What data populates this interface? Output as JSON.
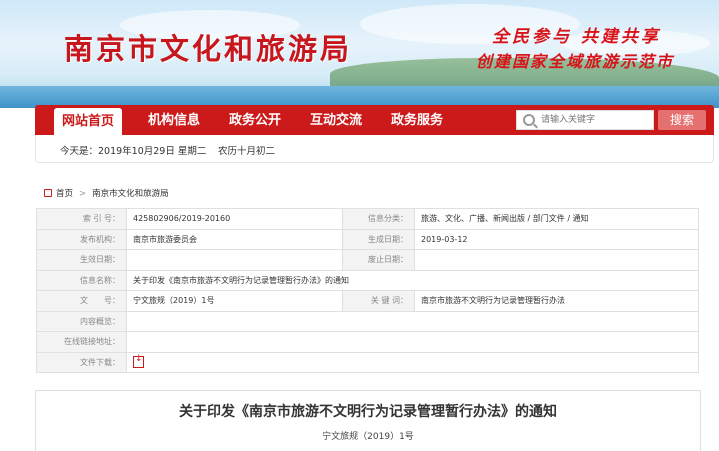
{
  "header": {
    "site_title": "南京市文化和旅游局",
    "slogan_line1": "全民参与 共建共享",
    "slogan_line2": "创建国家全域旅游示范市"
  },
  "nav": {
    "items": [
      {
        "label": "网站首页",
        "active": true
      },
      {
        "label": "机构信息"
      },
      {
        "label": "政务公开"
      },
      {
        "label": "互动交流"
      },
      {
        "label": "政务服务"
      }
    ],
    "search_placeholder": "请输入关键字",
    "search_button": "搜索"
  },
  "datebar": {
    "date": "今天是：2019年10月29日 星期二",
    "lunar": "农历十月初二"
  },
  "breadcrumb": {
    "home": "首页",
    "separator": ">",
    "current": "南京市文化和旅游局"
  },
  "info_table": {
    "index_label": "索 引 号：",
    "index_value": "425802906/2019-20160",
    "category_label": "信息分类：",
    "category_value": "旅游、文化、广播、新闻出版 / 部门文件 / 通知",
    "publisher_label": "发布机构：",
    "publisher_value": "南京市旅游委员会",
    "created_label": "生成日期：",
    "created_value": "2019-03-12",
    "effective_label": "生效日期：",
    "effective_value": "",
    "expire_label": "废止日期：",
    "expire_value": "",
    "name_label": "信息名称：",
    "name_value": "关于印发《南京市旅游不文明行为记录管理暂行办法》的通知",
    "docno_label": "文　　号：",
    "docno_value": "宁文旅规（2019）1号",
    "keywords_label": "关 键 词：",
    "keywords_value": "南京市旅游不文明行为记录管理暂行办法",
    "overview_label": "内容概览：",
    "overview_value": "",
    "link_label": "在线链接地址：",
    "link_value": "",
    "download_label": "文件下载：",
    "download_icon": "pdf-download-icon"
  },
  "article": {
    "title": "关于印发《南京市旅游不文明行为记录管理暂行办法》的通知",
    "doc_number": "宁文旅规（2019）1号"
  },
  "colors": {
    "brand_red": "#cc1a1a",
    "search_button": "#e57070"
  }
}
